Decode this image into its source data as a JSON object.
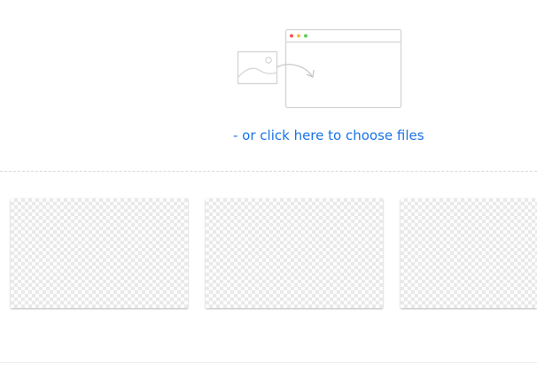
{
  "dropzone": {
    "illustration_icon": "image-to-browser-illustration",
    "choose_link_label": "- or click here to choose files",
    "link_color": "#1a73e8"
  },
  "thumbnails": [
    {
      "icon": "transparent-checkerboard"
    },
    {
      "icon": "transparent-checkerboard"
    },
    {
      "icon": "transparent-checkerboard"
    }
  ]
}
